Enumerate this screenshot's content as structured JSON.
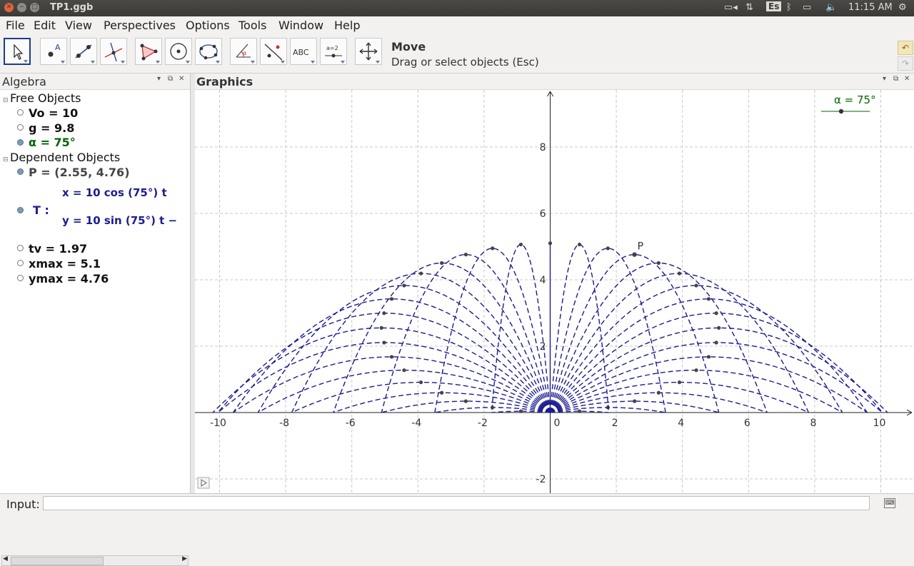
{
  "window": {
    "title": "TP1.ggb"
  },
  "tray": {
    "lang": "Es",
    "time": "11:15 AM"
  },
  "menu": [
    "File",
    "Edit",
    "View",
    "Perspectives",
    "Options",
    "Tools",
    "Window",
    "Help"
  ],
  "toolbar": {
    "tool_name": "Move",
    "tool_help": "Drag or select objects (Esc)",
    "icons": [
      "move-icon",
      "point-icon",
      "line-icon",
      "perpendicular-icon",
      "polygon-icon",
      "circle-icon",
      "conic-icon",
      "angle-icon",
      "reflect-icon",
      "text-icon",
      "slider-icon",
      "move-view-icon"
    ],
    "text_tool_label": "ABC",
    "slider_tool_label": "a=2"
  },
  "algebra": {
    "title": "Algebra",
    "free_label": "Free Objects",
    "free": [
      {
        "text": "Vo = 10",
        "color": "#111111",
        "shown": false
      },
      {
        "text": "g = 9.8",
        "color": "#111111",
        "shown": false
      },
      {
        "text": "α = 75°",
        "color": "#006400",
        "shown": true
      }
    ],
    "dependent_label": "Dependent Objects",
    "point_p": "P = (2.55, 4.76)",
    "curve_name": "T :",
    "curve_x": "x = 10  cos (75°)  t",
    "curve_y": "y = 10  sin (75°)  t −",
    "dependent": [
      {
        "text": "tv = 1.97",
        "shown": false
      },
      {
        "text": "xmax = 5.1",
        "shown": false
      },
      {
        "text": "ymax = 4.76",
        "shown": false
      }
    ]
  },
  "graphics": {
    "title": "Graphics",
    "slider_label": "α = 75°",
    "point_label": "P",
    "x_ticks": [
      "-10",
      "-8",
      "-6",
      "-4",
      "-2",
      "0",
      "2",
      "4",
      "6",
      "8",
      "10"
    ],
    "y_ticks": [
      "8",
      "6",
      "4",
      "2",
      "-2"
    ],
    "curve_color": "#1c1c8f",
    "projectile": {
      "v0": 10,
      "g": 9.8,
      "angles_deg": [
        5,
        10,
        15,
        20,
        25,
        30,
        35,
        40,
        45,
        50,
        55,
        60,
        65,
        70,
        75,
        80,
        85,
        90,
        95,
        100,
        105,
        110,
        115,
        120,
        125,
        130,
        135,
        140,
        145,
        150,
        155,
        160,
        165,
        170,
        175
      ],
      "point_p": [
        2.55,
        4.76
      ]
    }
  },
  "input": {
    "label": "Input:",
    "value": ""
  }
}
